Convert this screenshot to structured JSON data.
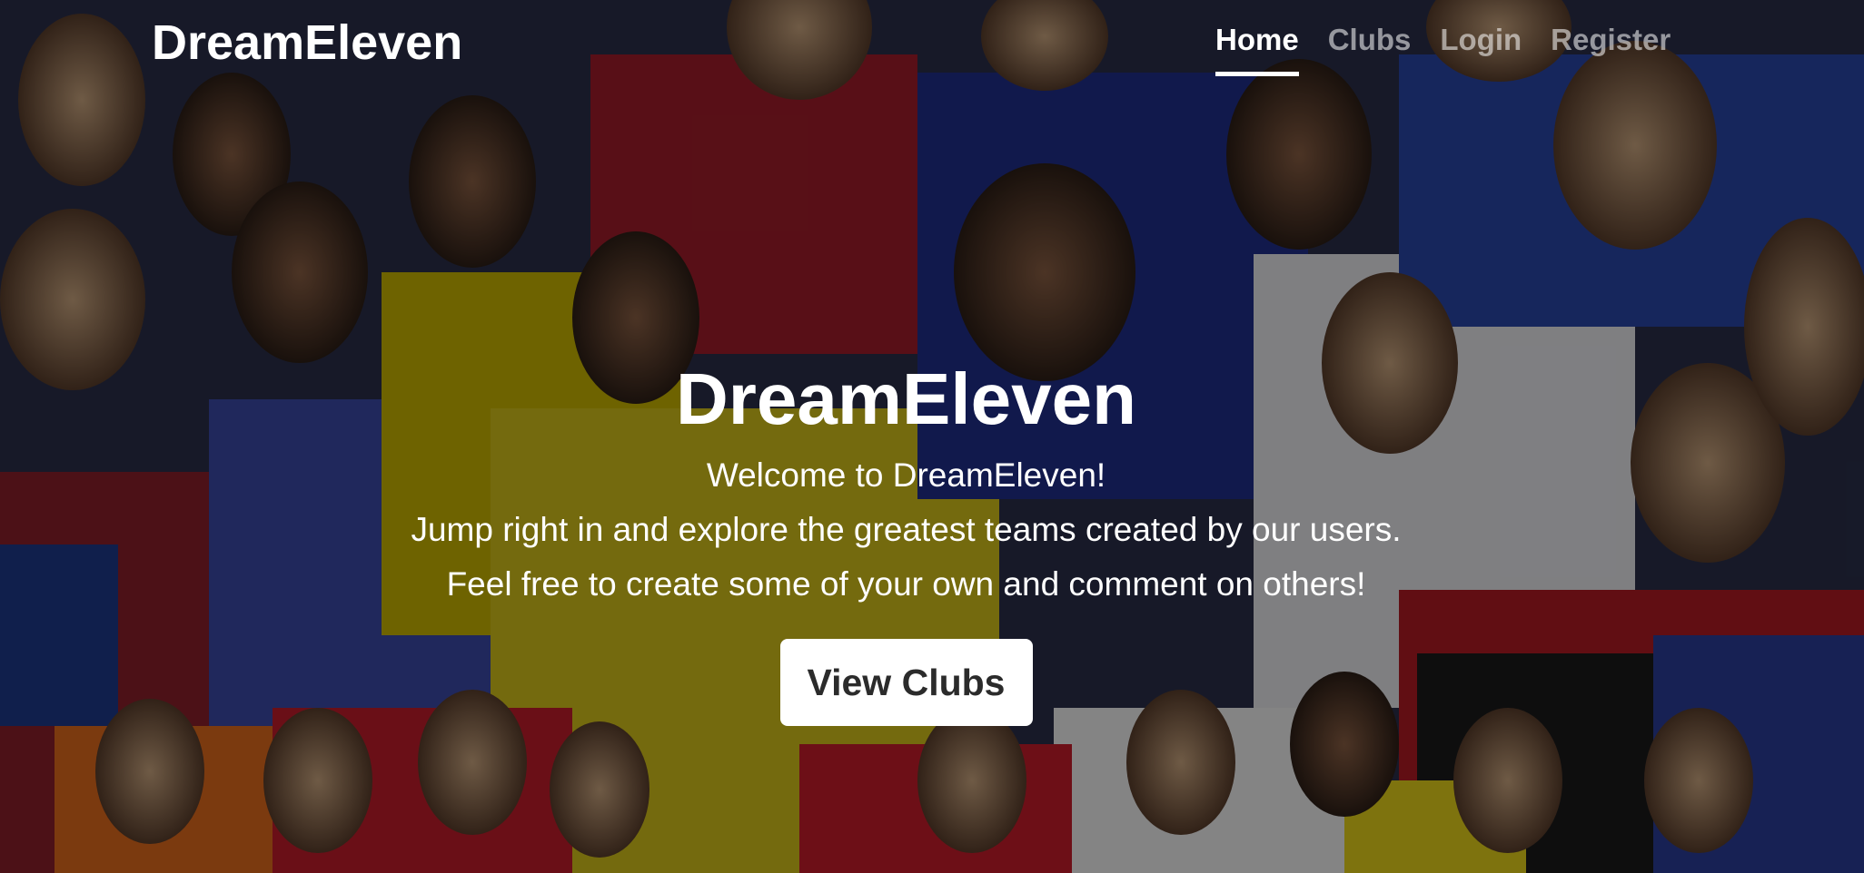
{
  "navbar": {
    "brand": "DreamEleven",
    "links": [
      {
        "label": "Home",
        "active": true
      },
      {
        "label": "Clubs",
        "active": false
      },
      {
        "label": "Login",
        "active": false
      },
      {
        "label": "Register",
        "active": false
      }
    ]
  },
  "hero": {
    "title": "DreamEleven",
    "lines": [
      "Welcome to DreamEleven!",
      "Jump right in and explore the greatest teams created by our users.",
      "Feel free to create some of your own and comment on others!"
    ],
    "button_label": "View Clubs"
  },
  "colors": {
    "text": "#ffffff",
    "button_bg": "#ffffff",
    "button_text": "#2b2b2b"
  }
}
